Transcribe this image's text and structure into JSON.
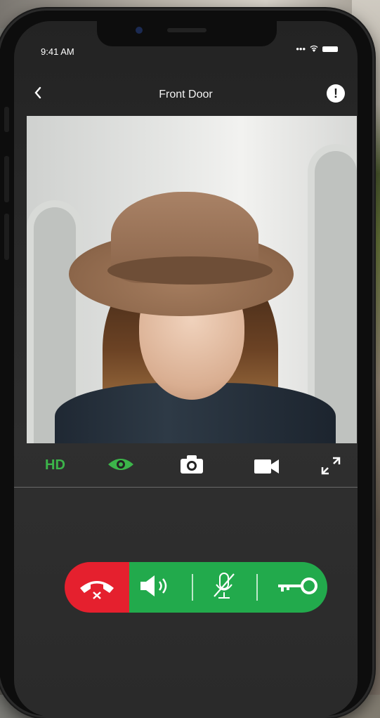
{
  "status_bar": {
    "time": "9:41 AM"
  },
  "nav": {
    "title": "Front Door"
  },
  "toolbar": {
    "hd_label": "HD"
  },
  "colors": {
    "accent_green": "#22aa4c",
    "hd_green": "#3cb54a",
    "hangup_red": "#e5202e"
  },
  "icons": {
    "back": "chevron-left-icon",
    "alert": "exclamation-icon",
    "view": "eye-icon",
    "snapshot": "camera-icon",
    "record": "video-camera-icon",
    "fullscreen": "expand-icon",
    "hangup": "phone-hangup-icon",
    "speaker": "speaker-icon",
    "mute": "mic-off-icon",
    "unlock": "key-icon"
  }
}
